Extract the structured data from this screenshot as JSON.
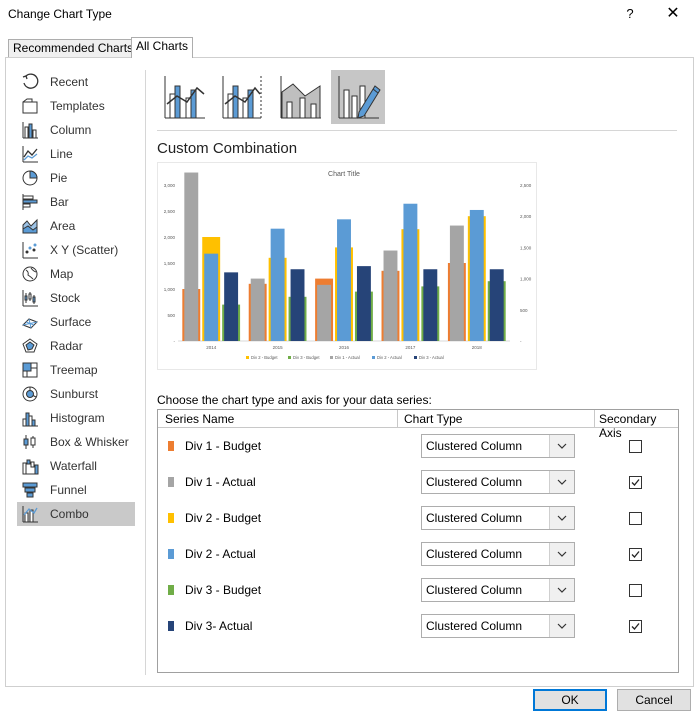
{
  "dialog": {
    "title": "Change Chart Type",
    "help_label": "?",
    "close_label": "✕"
  },
  "tabs": [
    {
      "label": "Recommended Charts"
    },
    {
      "label": "All Charts"
    }
  ],
  "nav": {
    "items": [
      {
        "label": "Recent",
        "icon": "recent-icon"
      },
      {
        "label": "Templates",
        "icon": "templates-icon"
      },
      {
        "label": "Column",
        "icon": "column-chart-icon"
      },
      {
        "label": "Line",
        "icon": "line-chart-icon"
      },
      {
        "label": "Pie",
        "icon": "pie-chart-icon"
      },
      {
        "label": "Bar",
        "icon": "bar-chart-icon"
      },
      {
        "label": "Area",
        "icon": "area-chart-icon"
      },
      {
        "label": "X Y (Scatter)",
        "icon": "scatter-chart-icon"
      },
      {
        "label": "Map",
        "icon": "map-chart-icon"
      },
      {
        "label": "Stock",
        "icon": "stock-chart-icon"
      },
      {
        "label": "Surface",
        "icon": "surface-chart-icon"
      },
      {
        "label": "Radar",
        "icon": "radar-chart-icon"
      },
      {
        "label": "Treemap",
        "icon": "treemap-chart-icon"
      },
      {
        "label": "Sunburst",
        "icon": "sunburst-chart-icon"
      },
      {
        "label": "Histogram",
        "icon": "histogram-chart-icon"
      },
      {
        "label": "Box & Whisker",
        "icon": "box-whisker-chart-icon"
      },
      {
        "label": "Waterfall",
        "icon": "waterfall-chart-icon"
      },
      {
        "label": "Funnel",
        "icon": "funnel-chart-icon"
      },
      {
        "label": "Combo",
        "icon": "combo-chart-icon"
      }
    ],
    "selected": "Combo"
  },
  "subtypes": {
    "items": [
      {
        "icon": "clustered-column-line-icon"
      },
      {
        "icon": "clustered-column-line-secondary-axis-icon"
      },
      {
        "icon": "stacked-area-clustered-column-icon"
      },
      {
        "icon": "custom-combination-icon"
      }
    ],
    "selected_index": 3
  },
  "heading": "Custom Combination",
  "preview_chart": {
    "chart_data": {
      "type": "bar",
      "title": "Chart Title",
      "categories": [
        "2014",
        "2015",
        "2016",
        "2017",
        "2018"
      ],
      "series": [
        {
          "name": "Div 1 - Budget",
          "color": "#ED7D31",
          "axis": "primary",
          "values": [
            1000,
            1100,
            1200,
            1350,
            1500
          ]
        },
        {
          "name": "Div 1 - Actual",
          "color": "#A5A5A5",
          "axis": "secondary",
          "values": [
            2700,
            1000,
            900,
            1450,
            1850
          ]
        },
        {
          "name": "Div 2 - Budget",
          "color": "#FFC000",
          "axis": "primary",
          "values": [
            2000,
            1600,
            1800,
            2150,
            2400
          ]
        },
        {
          "name": "Div 2 - Actual",
          "color": "#5B9BD5",
          "axis": "secondary",
          "values": [
            1400,
            1800,
            1950,
            2200,
            2100
          ]
        },
        {
          "name": "Div 3 - Budget",
          "color": "#70AD47",
          "axis": "primary",
          "values": [
            700,
            850,
            950,
            1050,
            1150
          ]
        },
        {
          "name": "Div 3 - Actual",
          "color": "#264478",
          "axis": "secondary",
          "values": [
            1100,
            1150,
            1200,
            1150,
            1150
          ]
        }
      ],
      "y_ticks_primary": [
        "3,000",
        "2,500",
        "2,000",
        "1,500",
        "1,000",
        "500",
        "-"
      ],
      "y_ticks_secondary": [
        "2,500",
        "2,000",
        "1,500",
        "1,000",
        "500",
        "-"
      ],
      "ylim_primary": [
        0,
        3000
      ],
      "ylim_secondary": [
        0,
        2500
      ],
      "legend_entries": [
        "Div 2 - Budget",
        "Div 3 - Budget",
        "Div 1 - Actual",
        "Div 2 - Actual",
        "Div 3 - Actual"
      ],
      "legend": "bottom",
      "grid": false
    }
  },
  "series_section": {
    "instruction": "Choose the chart type and axis for your data series:",
    "headers": {
      "series_name": "Series Name",
      "chart_type": "Chart Type",
      "secondary_axis": "Secondary Axis"
    },
    "rows": [
      {
        "name": "Div 1 - Budget",
        "color": "#ED7D31",
        "chart_type": "Clustered Column",
        "secondary": false
      },
      {
        "name": "Div 1 - Actual",
        "color": "#A5A5A5",
        "chart_type": "Clustered Column",
        "secondary": true
      },
      {
        "name": "Div 2 - Budget",
        "color": "#FFC000",
        "chart_type": "Clustered Column",
        "secondary": false
      },
      {
        "name": "Div 2 - Actual",
        "color": "#5B9BD5",
        "chart_type": "Clustered Column",
        "secondary": true
      },
      {
        "name": "Div 3 - Budget",
        "color": "#70AD47",
        "chart_type": "Clustered Column",
        "secondary": false
      },
      {
        "name": "Div 3- Actual",
        "color": "#264478",
        "chart_type": "Clustered Column",
        "secondary": true
      }
    ]
  },
  "buttons": {
    "ok": "OK",
    "cancel": "Cancel"
  }
}
